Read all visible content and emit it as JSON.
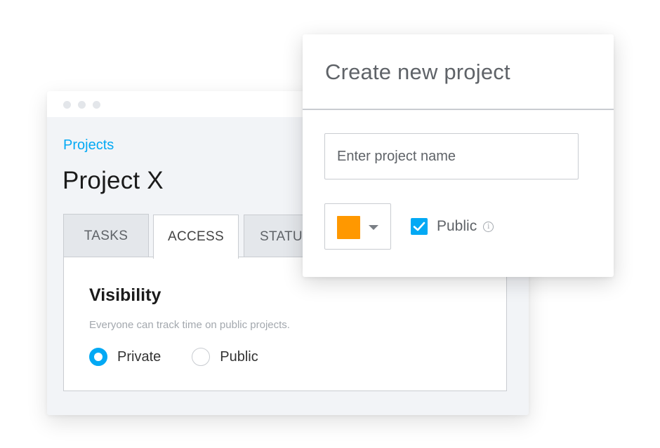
{
  "project_window": {
    "breadcrumb": "Projects",
    "title": "Project X",
    "tabs": [
      {
        "label": "TASKS",
        "active": false
      },
      {
        "label": "ACCESS",
        "active": true
      },
      {
        "label": "STATU",
        "active": false
      }
    ],
    "visibility": {
      "heading": "Visibility",
      "description": "Everyone can track time on public projects.",
      "options": [
        {
          "label": "Private",
          "selected": true
        },
        {
          "label": "Public",
          "selected": false
        }
      ]
    }
  },
  "modal": {
    "title": "Create new project",
    "name_input": {
      "placeholder": "Enter project name",
      "value": ""
    },
    "color": {
      "value": "#ff9800",
      "icon": "chevron-down-icon"
    },
    "public_checkbox": {
      "label": "Public",
      "checked": true,
      "info_icon": "info-icon"
    }
  },
  "colors": {
    "accent": "#03a9f4",
    "project_color": "#ff9800"
  }
}
